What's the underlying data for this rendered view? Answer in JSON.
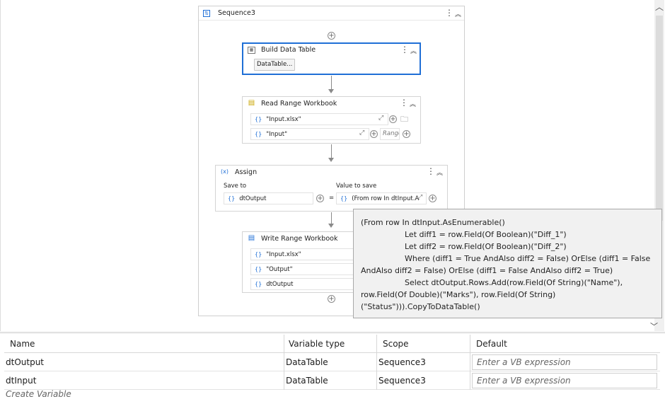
{
  "sequence": {
    "title": "Sequence3"
  },
  "build_data_table": {
    "title": "Build Data Table",
    "button_label": "DataTable..."
  },
  "read_range": {
    "title": "Read Range Workbook",
    "file_value": "\"Input.xlsx\"",
    "sheet_value": "\"Input\"",
    "range_placeholder": "Range"
  },
  "assign": {
    "title": "Assign",
    "save_to_label": "Save to",
    "value_label": "Value to save",
    "save_to_value": "dtOutput",
    "value_value": "(From row In dtInput.A",
    "equals": "="
  },
  "write_range": {
    "title": "Write Range Workbook",
    "file_value": "\"Input.xlsx\"",
    "sheet_value": "\"Output\"",
    "data_value": "dtOutput"
  },
  "tooltip": {
    "lines": [
      "(From row In dtInput.AsEnumerable()",
      "Let diff1 = row.Field(Of Boolean)(\"Diff_1\")",
      "Let diff2 = row.Field(Of Boolean)(\"Diff_2\")",
      "Where (diff1 = True AndAlso diff2 = False) OrElse (diff1 = False",
      "AndAlso diff2 = False) OrElse (diff1 = False AndAlso diff2 = True)",
      "Select dtOutput.Rows.Add(row.Field(Of String)(\"Name\"),",
      "row.Field(Of Double)(\"Marks\"), row.Field(Of String)",
      "(\"Status\"))).CopyToDataTable()"
    ]
  },
  "variables": {
    "headers": {
      "name": "Name",
      "type": "Variable type",
      "scope": "Scope",
      "default": "Default"
    },
    "rows": [
      {
        "name": "dtOutput",
        "type": "DataTable",
        "scope": "Sequence3",
        "default_placeholder": "Enter a VB expression"
      },
      {
        "name": "dtInput",
        "type": "DataTable",
        "scope": "Sequence3",
        "default_placeholder": "Enter a VB expression"
      }
    ],
    "create_label": "Create Variable"
  },
  "glyphs": {
    "dots": "⋮",
    "collapse": "︽",
    "plus": "+",
    "up": "︿",
    "down": "﹀",
    "expand": "⤢",
    "folder": "🗀"
  }
}
